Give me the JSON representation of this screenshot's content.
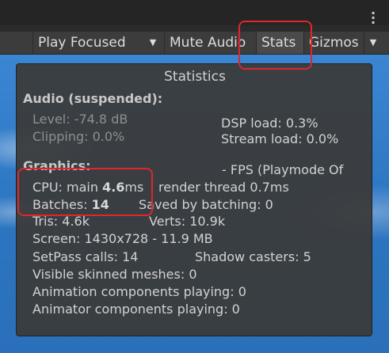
{
  "toolbar": {
    "play_focused": "Play Focused",
    "mute_audio": "Mute Audio",
    "stats": "Stats",
    "gizmos": "Gizmos"
  },
  "stats": {
    "title": "Statistics",
    "audio": {
      "header": "Audio (suspended):",
      "level": "Level: -74.8 dB",
      "clipping": "Clipping: 0.0%",
      "dsp_load": "DSP load: 0.3%",
      "stream_load": "Stream load: 0.0%"
    },
    "graphics": {
      "header": "Graphics:",
      "fps": "- FPS (Playmode Of",
      "cpu_prefix": "CPU: main ",
      "cpu_main": "4.6",
      "cpu_suffix": "ms",
      "render_thread": "render thread 0.7ms",
      "batches_prefix": "Batches: ",
      "batches_value": "14",
      "saved_by_batching": "Saved by batching: 0",
      "tris": "Tris: 4.6k",
      "verts": "Verts: 10.9k",
      "screen": "Screen: 1430x728 - 11.9 MB",
      "setpass": "SetPass calls: 14",
      "shadow_casters": "Shadow casters: 5",
      "skinned_meshes": "Visible skinned meshes: 0",
      "animation_components": "Animation components playing: 0",
      "animator_components": "Animator components playing: 0"
    }
  },
  "colors": {
    "highlight": "#e0262b",
    "panel_bg": "#3a3a3a",
    "toolbar_bg": "#3c3c3c"
  },
  "icons": [
    "kebab-menu-icon",
    "dropdown-arrow-icon"
  ]
}
